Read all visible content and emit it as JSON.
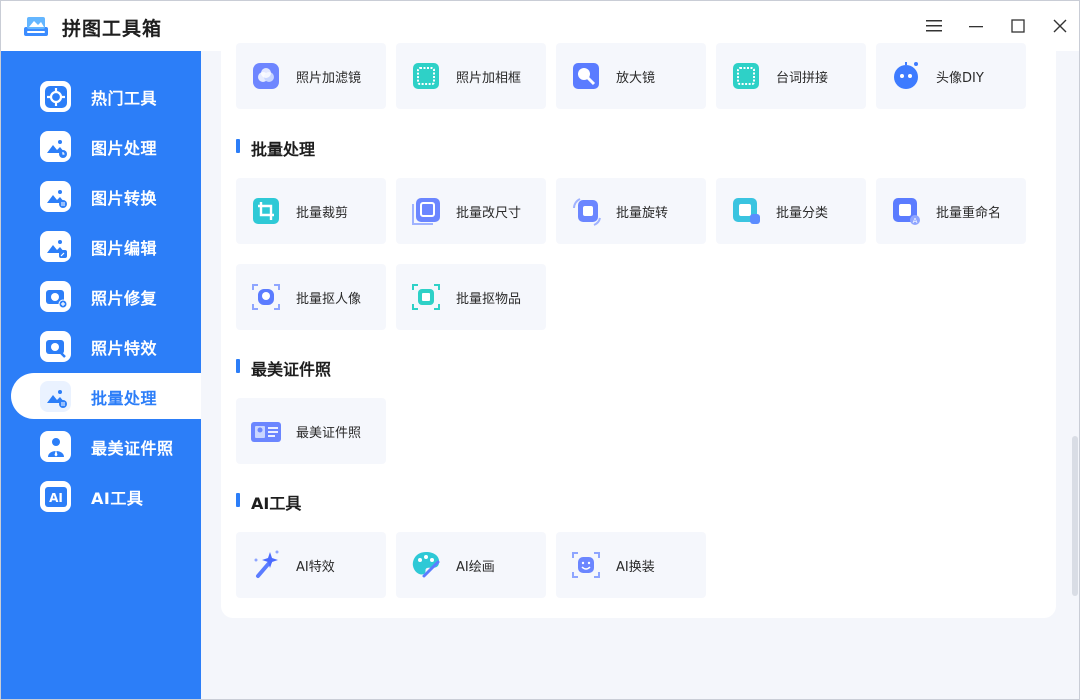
{
  "app": {
    "title": "拼图工具箱"
  },
  "window_controls": [
    "menu-icon",
    "minimize-icon",
    "maximize-icon",
    "close-icon"
  ],
  "sidebar": {
    "items": [
      {
        "label": "热门工具",
        "icon": "hot-tools-icon",
        "active": false
      },
      {
        "label": "图片处理",
        "icon": "image-process-icon",
        "active": false
      },
      {
        "label": "图片转换",
        "icon": "image-convert-icon",
        "active": false
      },
      {
        "label": "图片编辑",
        "icon": "image-edit-icon",
        "active": false
      },
      {
        "label": "照片修复",
        "icon": "photo-repair-icon",
        "active": false
      },
      {
        "label": "照片特效",
        "icon": "photo-effect-icon",
        "active": false
      },
      {
        "label": "批量处理",
        "icon": "batch-process-icon",
        "active": true
      },
      {
        "label": "最美证件照",
        "icon": "id-photo-icon",
        "active": false
      },
      {
        "label": "AI工具",
        "icon": "ai-tools-icon",
        "active": false
      }
    ]
  },
  "top_row": [
    {
      "label": "照片加滤镜",
      "icon": "filter-icon"
    },
    {
      "label": "照片加相框",
      "icon": "frame-icon"
    },
    {
      "label": "放大镜",
      "icon": "magnifier-icon"
    },
    {
      "label": "台词拼接",
      "icon": "subtitle-stitch-icon"
    },
    {
      "label": "头像DIY",
      "icon": "avatar-diy-icon"
    }
  ],
  "sections": {
    "batch": {
      "title": "批量处理",
      "cards": [
        {
          "label": "批量裁剪",
          "icon": "crop-icon"
        },
        {
          "label": "批量改尺寸",
          "icon": "resize-icon"
        },
        {
          "label": "批量旋转",
          "icon": "rotate-icon"
        },
        {
          "label": "批量分类",
          "icon": "classify-icon"
        },
        {
          "label": "批量重命名",
          "icon": "rename-icon"
        },
        {
          "label": "批量抠人像",
          "icon": "cutout-portrait-icon"
        },
        {
          "label": "批量抠物品",
          "icon": "cutout-object-icon"
        }
      ]
    },
    "idphoto": {
      "title": "最美证件照",
      "cards": [
        {
          "label": "最美证件照",
          "icon": "id-card-icon"
        }
      ]
    },
    "ai": {
      "title": "AI工具",
      "cards": [
        {
          "label": "AI特效",
          "icon": "magic-wand-icon"
        },
        {
          "label": "AI绘画",
          "icon": "palette-icon"
        },
        {
          "label": "AI换装",
          "icon": "face-swap-icon"
        }
      ]
    }
  },
  "colors": {
    "accent": "#2c7ef8",
    "card_bg": "#f5f7fc",
    "panel_bg": "#ffffff"
  }
}
